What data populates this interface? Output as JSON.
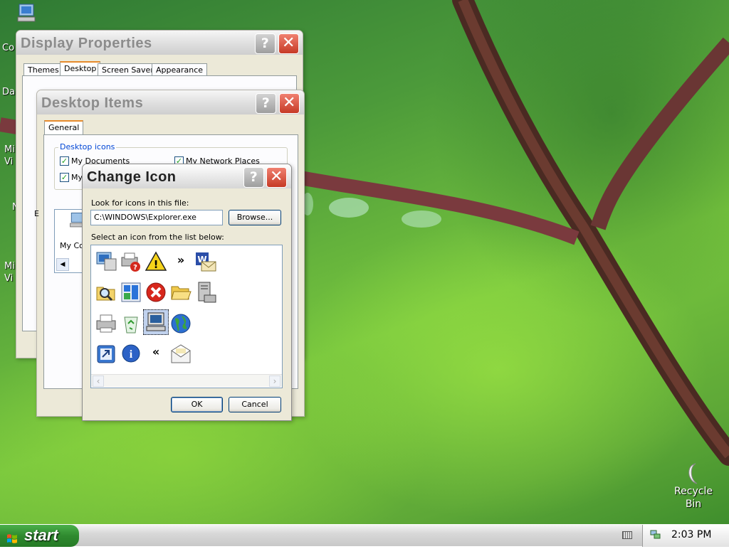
{
  "desktop": {
    "icons": [
      {
        "name": "my-computer",
        "label": "Co"
      },
      {
        "name": "my-documents",
        "label": "Da"
      },
      {
        "name": "mi-vi-1",
        "label": "Mi\nVi"
      },
      {
        "name": "n-cut",
        "label": "N"
      },
      {
        "name": "mi-vi-2",
        "label": "Mi\nVi"
      }
    ],
    "recycle_bin": "Recycle\nBin"
  },
  "display_properties": {
    "title": "Display Properties",
    "help": "?",
    "close": "✕",
    "tabs": [
      "Themes",
      "Desktop",
      "Screen Saver",
      "Appearance"
    ],
    "selected_tab": "Desktop"
  },
  "desktop_items": {
    "title": "Desktop Items",
    "help": "?",
    "close": "✕",
    "tab": "General",
    "group_label": "Desktop icons",
    "checkboxes": [
      {
        "label": "My Documents",
        "checked": true
      },
      {
        "label": "My Network Places",
        "checked": true
      },
      {
        "label": "My",
        "checked": true
      }
    ],
    "list_label_partial": "E",
    "preview_icon_label": "My Co",
    "scroll_left": "◀"
  },
  "change_icon": {
    "title": "Change Icon",
    "help": "?",
    "close": "✕",
    "look_label": "Look for icons in this file:",
    "file_path": "C:\\WINDOWS\\Explorer.exe",
    "browse_button": "Browse...",
    "select_label": "Select an icon from the list below:",
    "ok_button": "OK",
    "cancel_button": "Cancel",
    "scroll_left": "‹",
    "scroll_right": "›",
    "icons": [
      {
        "name": "computer-network-icon"
      },
      {
        "name": "printer-help-icon"
      },
      {
        "name": "warning-icon"
      },
      {
        "name": "forward-chevron-icon",
        "glyph": "»"
      },
      {
        "name": "word-document-icon"
      },
      {
        "name": "search-folder-icon"
      },
      {
        "name": "windows-update-icon"
      },
      {
        "name": "error-icon"
      },
      {
        "name": "open-folder-icon"
      },
      {
        "name": "server-icon"
      },
      {
        "name": "printer-icon"
      },
      {
        "name": "recycle-bin-icon"
      },
      {
        "name": "monitor-icon"
      },
      {
        "name": "globe-icon"
      },
      {
        "name": "run-icon"
      },
      {
        "name": "information-icon"
      },
      {
        "name": "back-chevron-icon",
        "glyph": "«"
      },
      {
        "name": "mail-icon"
      }
    ],
    "selected_icon": "monitor-icon"
  },
  "taskbar": {
    "start_label": "start",
    "clock": "2:03 PM"
  }
}
